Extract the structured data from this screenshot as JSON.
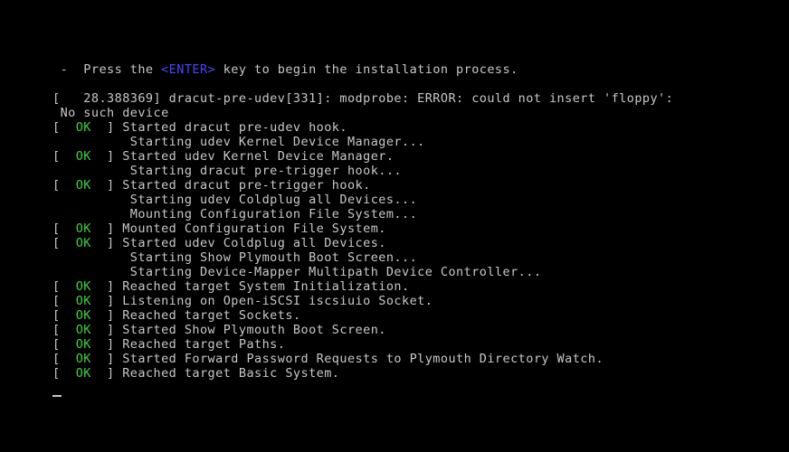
{
  "colors": {
    "background": "#000000",
    "text": "#c8c8c8",
    "ok": "#3cd23c",
    "key_highlight": "#4848ff"
  },
  "prompt": {
    "prefix": " -  Press the ",
    "key": "<ENTER>",
    "suffix": " key to begin the installation process."
  },
  "error": {
    "line1": "[   28.388369] dracut-pre-udev[331]: modprobe: ERROR: could not insert 'floppy':",
    "line2": " No such device"
  },
  "log": [
    {
      "status": "OK",
      "message": "Started dracut pre-udev hook."
    },
    {
      "status": "",
      "message": "Starting udev Kernel Device Manager..."
    },
    {
      "status": "OK",
      "message": "Started udev Kernel Device Manager."
    },
    {
      "status": "",
      "message": "Starting dracut pre-trigger hook..."
    },
    {
      "status": "OK",
      "message": "Started dracut pre-trigger hook."
    },
    {
      "status": "",
      "message": "Starting udev Coldplug all Devices..."
    },
    {
      "status": "",
      "message": "Mounting Configuration File System..."
    },
    {
      "status": "OK",
      "message": "Mounted Configuration File System."
    },
    {
      "status": "OK",
      "message": "Started udev Coldplug all Devices."
    },
    {
      "status": "",
      "message": "Starting Show Plymouth Boot Screen..."
    },
    {
      "status": "",
      "message": "Starting Device-Mapper Multipath Device Controller..."
    },
    {
      "status": "OK",
      "message": "Reached target System Initialization."
    },
    {
      "status": "OK",
      "message": "Listening on Open-iSCSI iscsiuio Socket."
    },
    {
      "status": "OK",
      "message": "Reached target Sockets."
    },
    {
      "status": "OK",
      "message": "Started Show Plymouth Boot Screen."
    },
    {
      "status": "OK",
      "message": "Reached target Paths."
    },
    {
      "status": "OK",
      "message": "Started Forward Password Requests to Plymouth Directory Watch."
    },
    {
      "status": "OK",
      "message": "Reached target Basic System."
    }
  ],
  "cursor": "_"
}
